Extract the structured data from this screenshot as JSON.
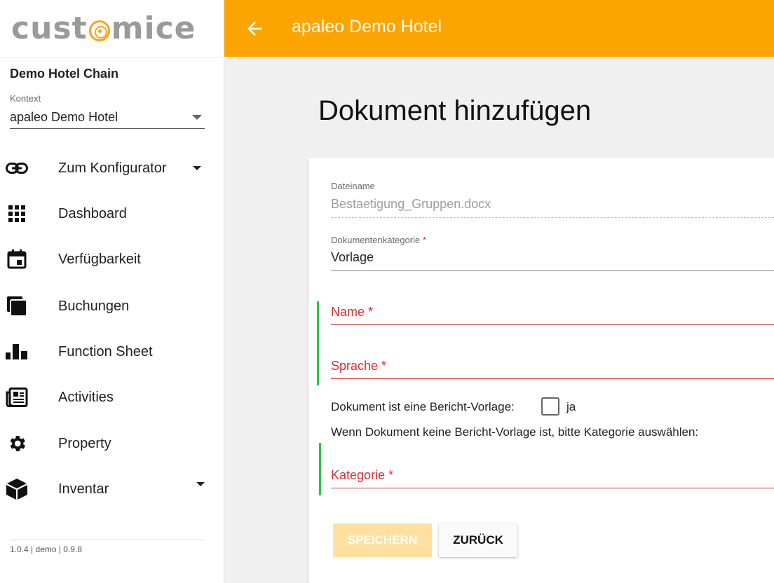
{
  "logo": {
    "text_before": "cust",
    "text_after": "mice"
  },
  "sidebar": {
    "chain": "Demo Hotel Chain",
    "context_label": "Kontext",
    "context_value": "apaleo Demo Hotel",
    "items": [
      {
        "label": "Zum Konfigurator",
        "icon": "link-icon"
      },
      {
        "label": "Dashboard",
        "icon": "grid-icon"
      },
      {
        "label": "Verfügbarkeit",
        "icon": "calendar-icon"
      },
      {
        "label": "Buchungen",
        "icon": "copy-icon"
      },
      {
        "label": "Function Sheet",
        "icon": "bar-chart-icon"
      },
      {
        "label": "Activities",
        "icon": "newspaper-icon"
      },
      {
        "label": "Property",
        "icon": "gear-icon"
      },
      {
        "label": "Inventar",
        "icon": "cube-icon"
      }
    ],
    "version": "1.0.4 | demo | 0.9.8"
  },
  "topbar": {
    "title": "apaleo Demo Hotel"
  },
  "page": {
    "title": "Dokument hinzufügen"
  },
  "form": {
    "filename_label": "Dateiname",
    "filename_value": "Bestaetigung_Gruppen.docx",
    "category_label": "Dokumentenkategorie",
    "required_mark": "*",
    "category_value": "Vorlage",
    "name_label": "Name *",
    "language_label": "Sprache *",
    "report_template_label": "Dokument ist eine Bericht-Vorlage:",
    "report_template_option": "ja",
    "hint": "Wenn Dokument keine Bericht-Vorlage ist, bitte Kategorie auswählen:",
    "kategorie_label": "Kategorie *"
  },
  "buttons": {
    "save": "SPEICHERN",
    "back": "ZURÜCK"
  },
  "colors": {
    "accent": "#fca500",
    "error": "#d32f2f",
    "valid": "#2ec44a"
  }
}
